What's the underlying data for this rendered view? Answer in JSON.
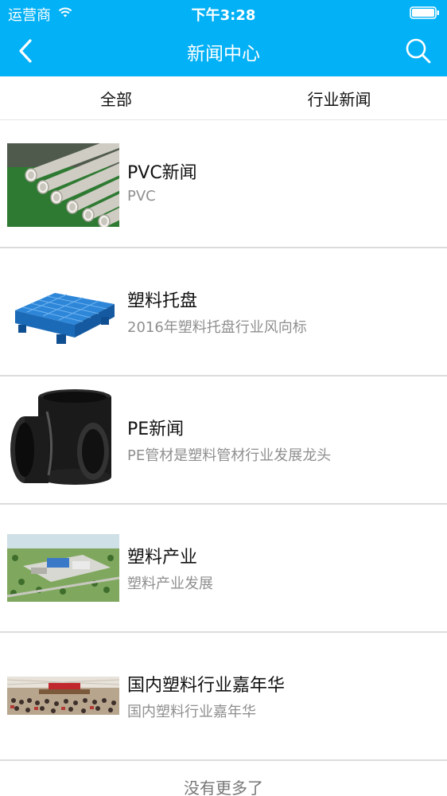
{
  "status_bar": {
    "carrier": "运营商",
    "time": "下午3:28"
  },
  "nav": {
    "title": "新闻中心",
    "back_icon": "chevron-left-icon",
    "search_icon": "search-icon"
  },
  "tabs": [
    {
      "label": "全部"
    },
    {
      "label": "行业新闻"
    }
  ],
  "news": [
    {
      "title": "PVC新闻",
      "subtitle": "PVC",
      "thumb": "pvc-pipes-image"
    },
    {
      "title": "塑料托盘",
      "subtitle": "2016年塑料托盘行业风向标",
      "thumb": "plastic-pallet-image"
    },
    {
      "title": "PE新闻",
      "subtitle": "PE管材是塑料管材行业发展龙头",
      "thumb": "pe-fitting-image"
    },
    {
      "title": "塑料产业",
      "subtitle": "塑料产业发展",
      "thumb": "industrial-park-image"
    },
    {
      "title": "国内塑料行业嘉年华",
      "subtitle": "国内塑料行业嘉年华",
      "thumb": "conference-image"
    }
  ],
  "footer": {
    "text": "没有更多了"
  },
  "colors": {
    "header": "#03b1f6",
    "subtitle": "#8f8f8f",
    "divider": "#dcdcdc"
  }
}
